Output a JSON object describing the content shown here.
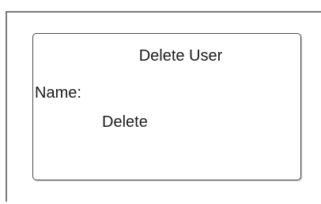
{
  "dialog": {
    "title": "Delete User",
    "name_label": "Name:",
    "delete_label": "Delete"
  }
}
